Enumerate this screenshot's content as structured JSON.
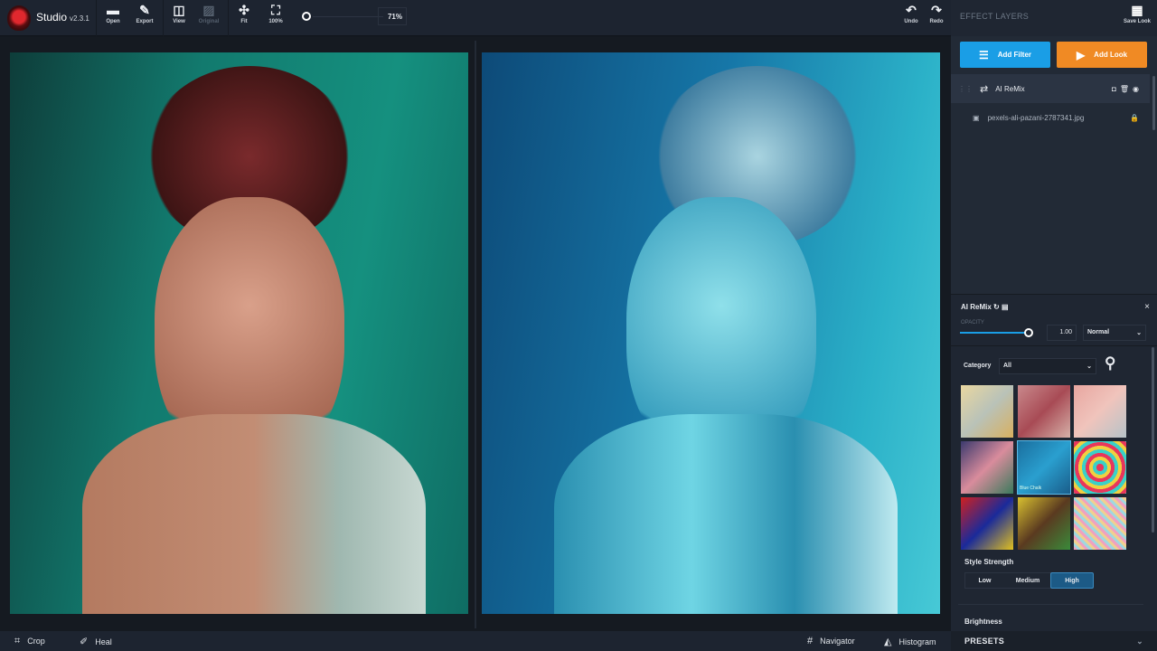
{
  "app": {
    "name": "Studio",
    "version": "v2.3.1"
  },
  "toolbar": {
    "items": [
      {
        "label": "Open",
        "icon": "folder-icon"
      },
      {
        "label": "Export",
        "icon": "export-icon"
      },
      {
        "label": "View",
        "icon": "split-view-icon"
      },
      {
        "label": "Original",
        "icon": "image-icon",
        "disabled": true
      },
      {
        "label": "Fit",
        "icon": "fit-icon"
      },
      {
        "label": "100%",
        "icon": "actual-size-icon"
      }
    ],
    "zoom": "71%",
    "undo": "Undo",
    "redo": "Redo"
  },
  "bottom": {
    "crop": "Crop",
    "heal": "Heal",
    "navigator": "Navigator",
    "histogram": "Histogram"
  },
  "panel": {
    "title": "EFFECT LAYERS",
    "save_look": "Save Look",
    "add_filter": "Add Filter",
    "add_look": "Add Look",
    "add_filter_color": "#1a9ee6",
    "add_look_color": "#f08a24",
    "layers": [
      {
        "name": "AI ReMix"
      },
      {
        "name": "pexels-ali-pazani-2787341.jpg",
        "locked": true
      }
    ]
  },
  "remix": {
    "title": "AI ReMix",
    "opacity_label": "OPACITY",
    "opacity": "1.00",
    "blend": "Normal",
    "category_label": "Category",
    "category": "All",
    "hover_label": "Blue Chalk",
    "style_strength_label": "Style Strength",
    "strength": [
      "Low",
      "Medium",
      "High"
    ],
    "strength_selected": "High",
    "brightness_label": "Brightness"
  },
  "presets": "PRESETS"
}
